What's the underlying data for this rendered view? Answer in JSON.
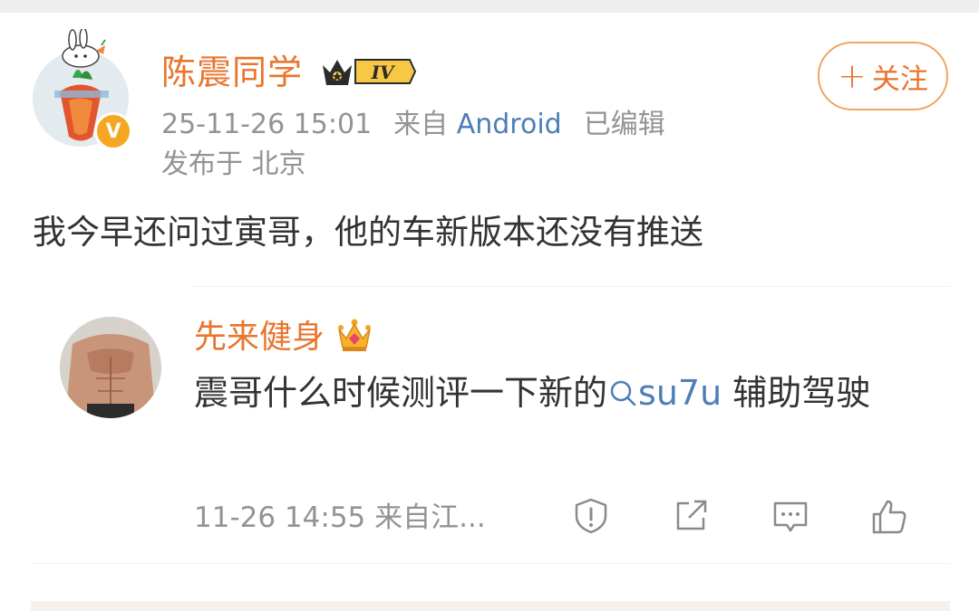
{
  "post": {
    "author_name": "陈震同学",
    "level_badge": "IV",
    "avatar_badge": "V",
    "timestamp": "25-11-26 15:01",
    "source_prefix": "来自",
    "source": "Android",
    "edited": "已编辑",
    "location": "发布于 北京",
    "follow_label": "关注",
    "follow_plus": "+",
    "text": "我今早还问过寅哥，他的车新版本还没有推送"
  },
  "comment": {
    "author_name": "先来健身",
    "text_before": "震哥什么时候测评一下新的",
    "topic": "su7u",
    "text_after": " 辅助驾驶",
    "time": "11-26 14:55",
    "source": "来自江...",
    "actions": [
      "report-icon",
      "share-icon",
      "comment-icon",
      "like-icon"
    ]
  },
  "colors": {
    "accent": "#e8762d",
    "link": "#4d7eb5",
    "meta": "#939393",
    "text": "#333333"
  }
}
